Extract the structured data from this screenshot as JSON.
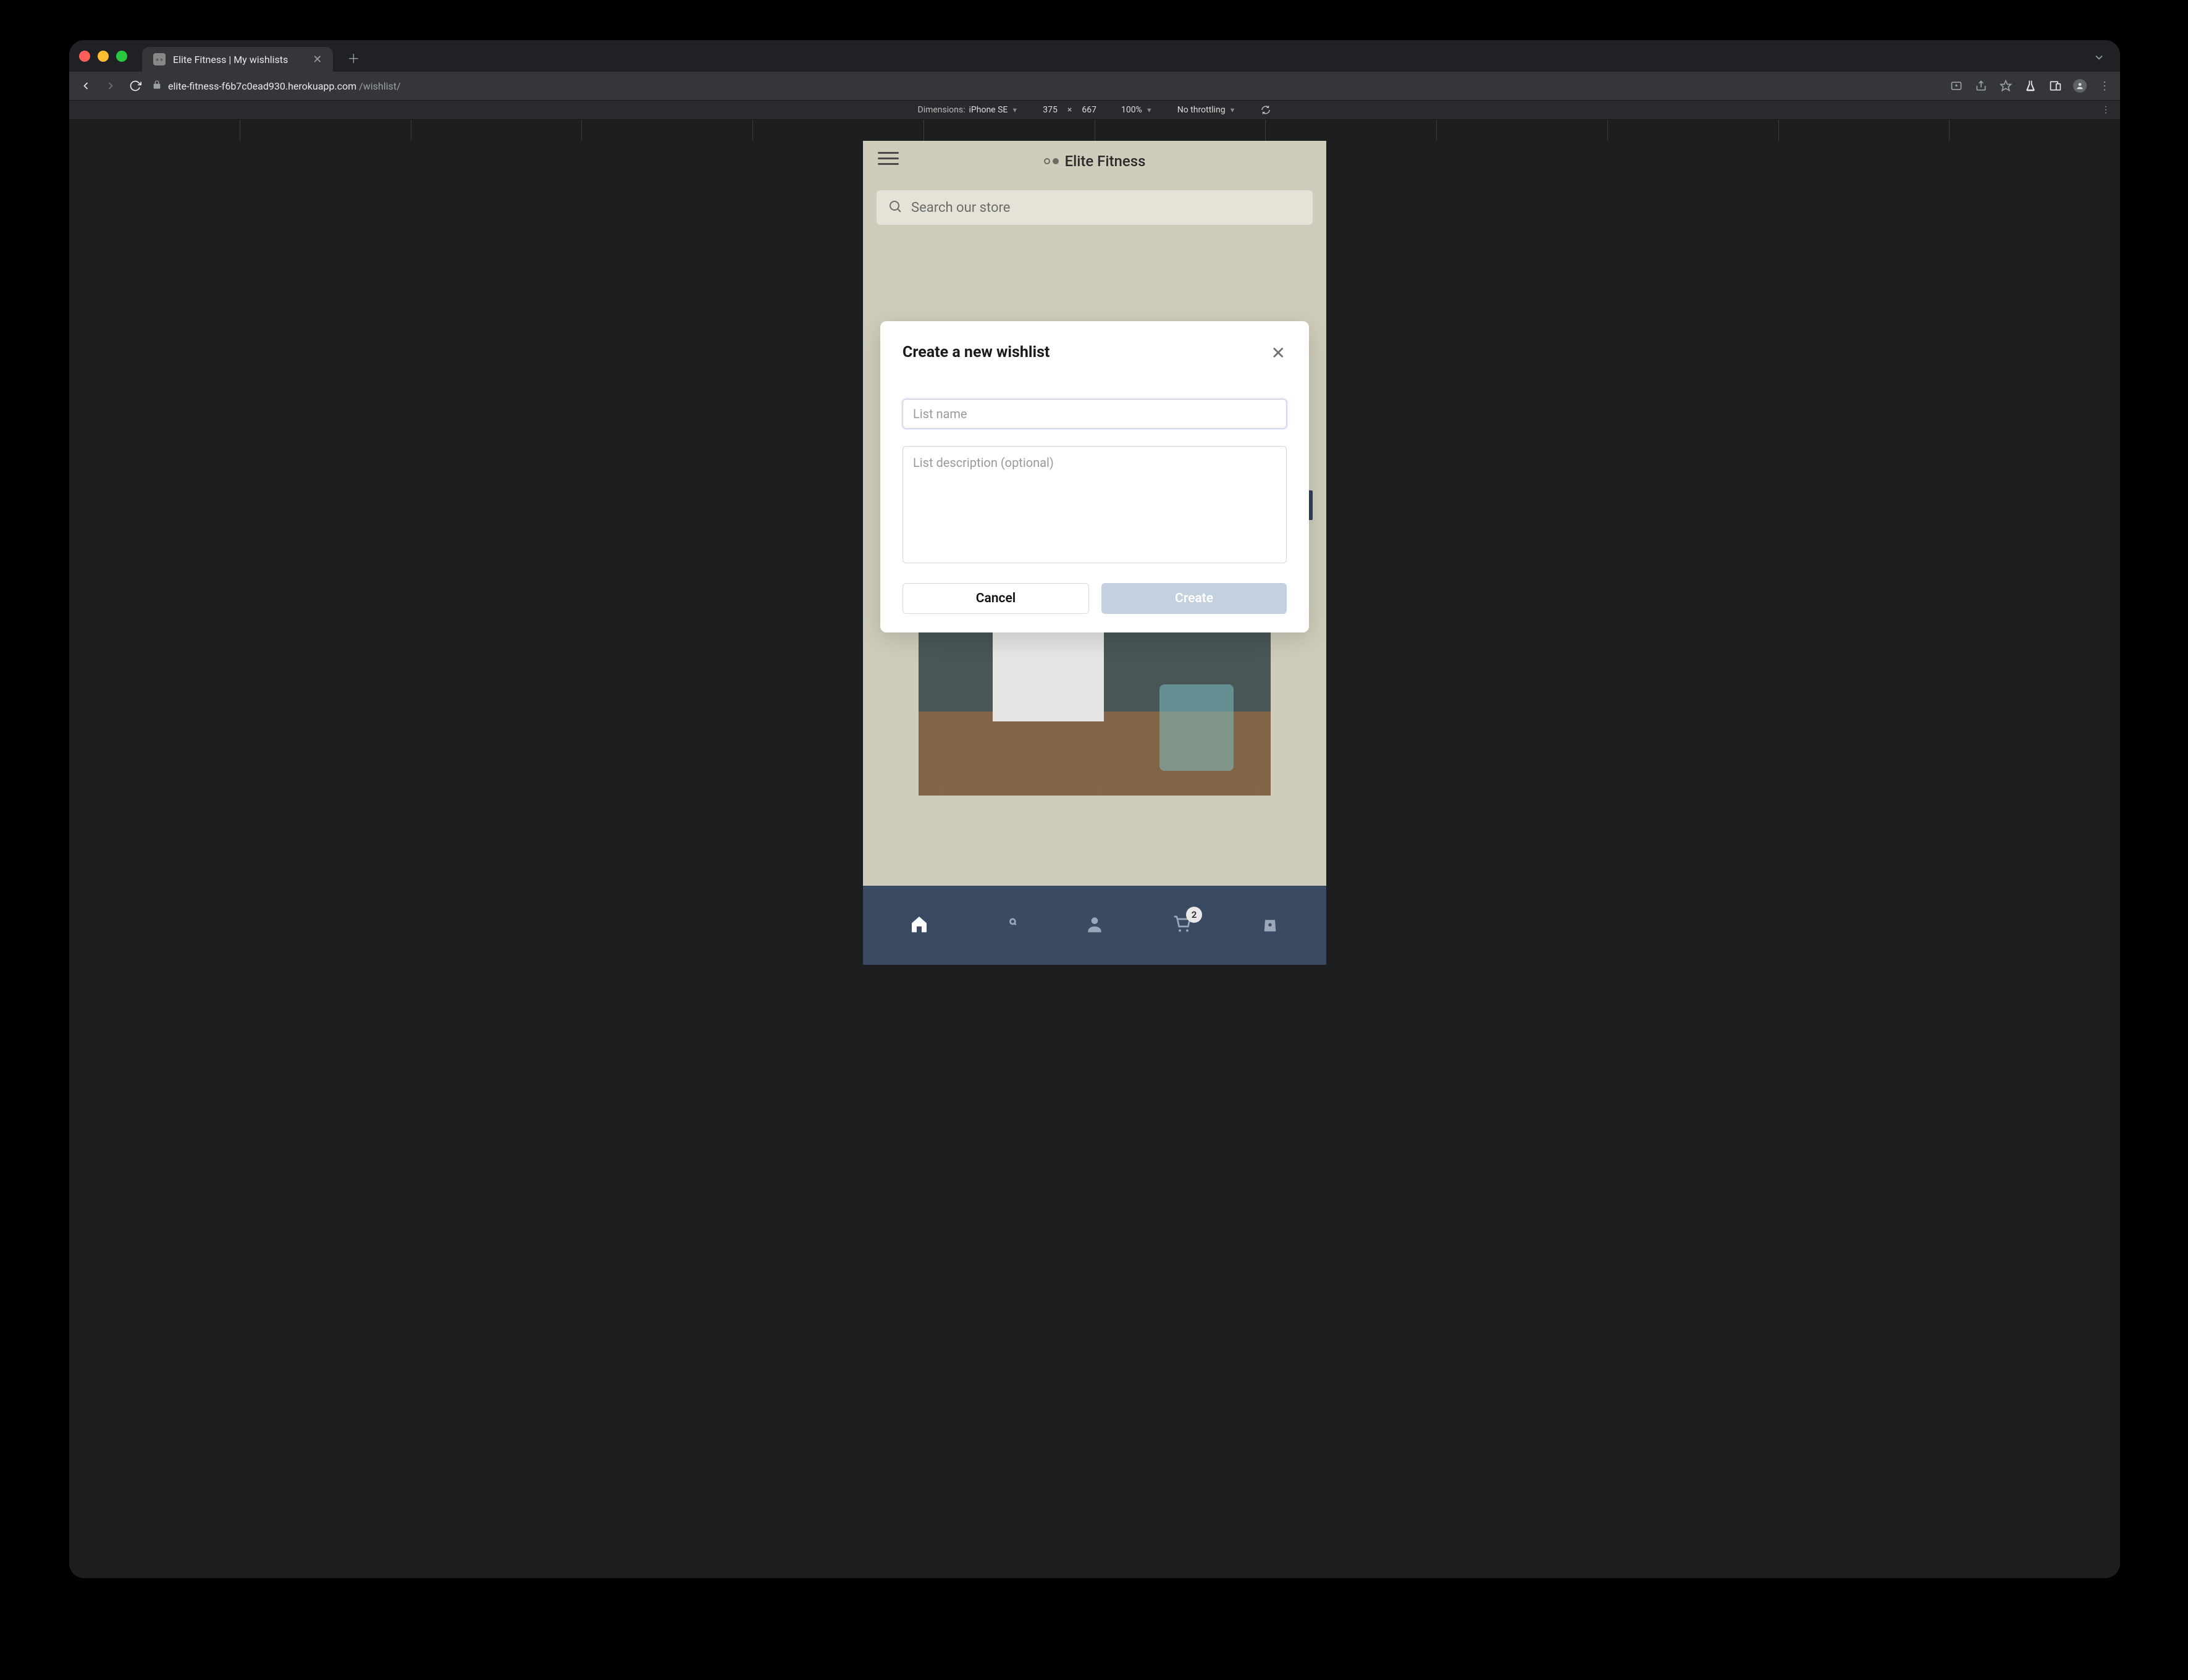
{
  "browser": {
    "tab_title": "Elite Fitness | My wishlists",
    "url_domain": "elite-fitness-f6b7c0ead930.herokuapp.com",
    "url_path": "/wishlist/"
  },
  "devtools": {
    "dimensions_label": "Dimensions:",
    "device_name": "iPhone SE",
    "width": "375",
    "times": "×",
    "height": "667",
    "zoom": "100%",
    "throttling": "No throttling"
  },
  "app": {
    "brand": "Elite Fitness",
    "search_placeholder": "Search our store"
  },
  "modal": {
    "title": "Create a new wishlist",
    "name_placeholder": "List name",
    "desc_placeholder": "List description (optional)",
    "cancel_label": "Cancel",
    "create_label": "Create"
  },
  "bottom_nav": {
    "cart_count": "2"
  }
}
